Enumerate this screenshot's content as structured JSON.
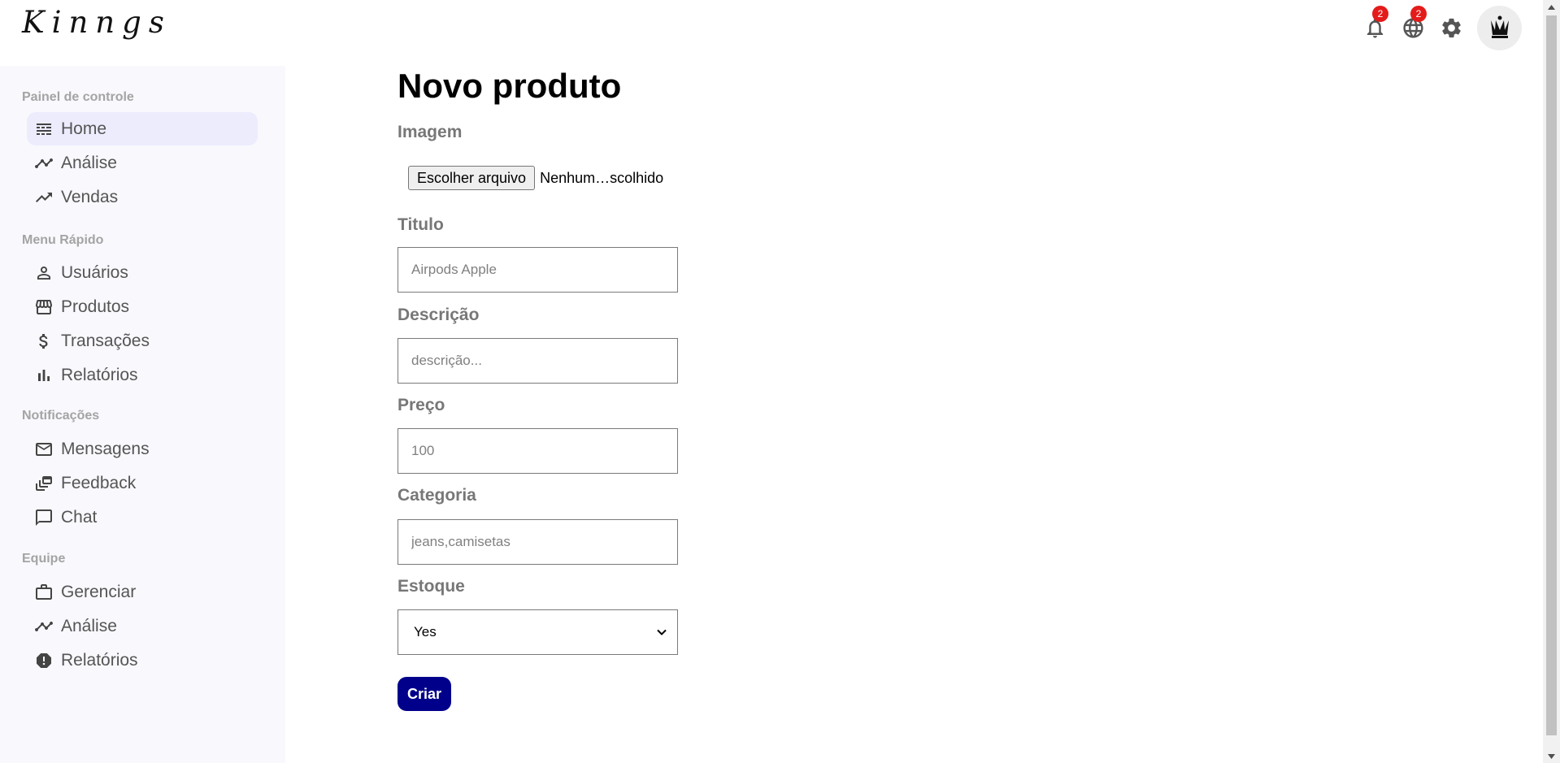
{
  "app": {
    "logo": "Kinngs"
  },
  "header": {
    "notifications_badge": "2",
    "language_badge": "2"
  },
  "sidebar": {
    "sections": [
      {
        "title": "Painel de controle",
        "items": [
          {
            "label": "Home",
            "icon": "dashboard-icon",
            "active": true
          },
          {
            "label": "Análise",
            "icon": "timeline-icon"
          },
          {
            "label": "Vendas",
            "icon": "trending-up-icon"
          }
        ]
      },
      {
        "title": "Menu Rápido",
        "items": [
          {
            "label": "Usuários",
            "icon": "person-icon"
          },
          {
            "label": "Produtos",
            "icon": "storefront-icon"
          },
          {
            "label": "Transações",
            "icon": "dollar-icon"
          },
          {
            "label": "Relatórios",
            "icon": "bar-chart-icon"
          }
        ]
      },
      {
        "title": "Notificações",
        "items": [
          {
            "label": "Mensagens",
            "icon": "mail-icon"
          },
          {
            "label": "Feedback",
            "icon": "dynamic-feed-icon"
          },
          {
            "label": "Chat",
            "icon": "chat-bubble-icon"
          }
        ]
      },
      {
        "title": "Equipe",
        "items": [
          {
            "label": "Gerenciar",
            "icon": "briefcase-icon"
          },
          {
            "label": "Análise",
            "icon": "timeline-icon"
          },
          {
            "label": "Relatórios",
            "icon": "report-icon"
          }
        ]
      }
    ]
  },
  "form": {
    "title": "Novo produto",
    "image_label": "Imagem",
    "file_button": "Escolher arquivo",
    "file_status": "Nenhum…scolhido",
    "title_label": "Titulo",
    "title_placeholder": "Airpods Apple",
    "description_label": "Descrição",
    "description_placeholder": "descrição...",
    "price_label": "Preço",
    "price_placeholder": "100",
    "category_label": "Categoria",
    "category_placeholder": "jeans,camisetas",
    "stock_label": "Estoque",
    "stock_value": "Yes",
    "submit_label": "Criar"
  },
  "colors": {
    "primary": "#00008b",
    "sidebar_bg": "#f8f8fd",
    "active_item_bg": "#ececfd",
    "badge": "#e41b1b"
  }
}
